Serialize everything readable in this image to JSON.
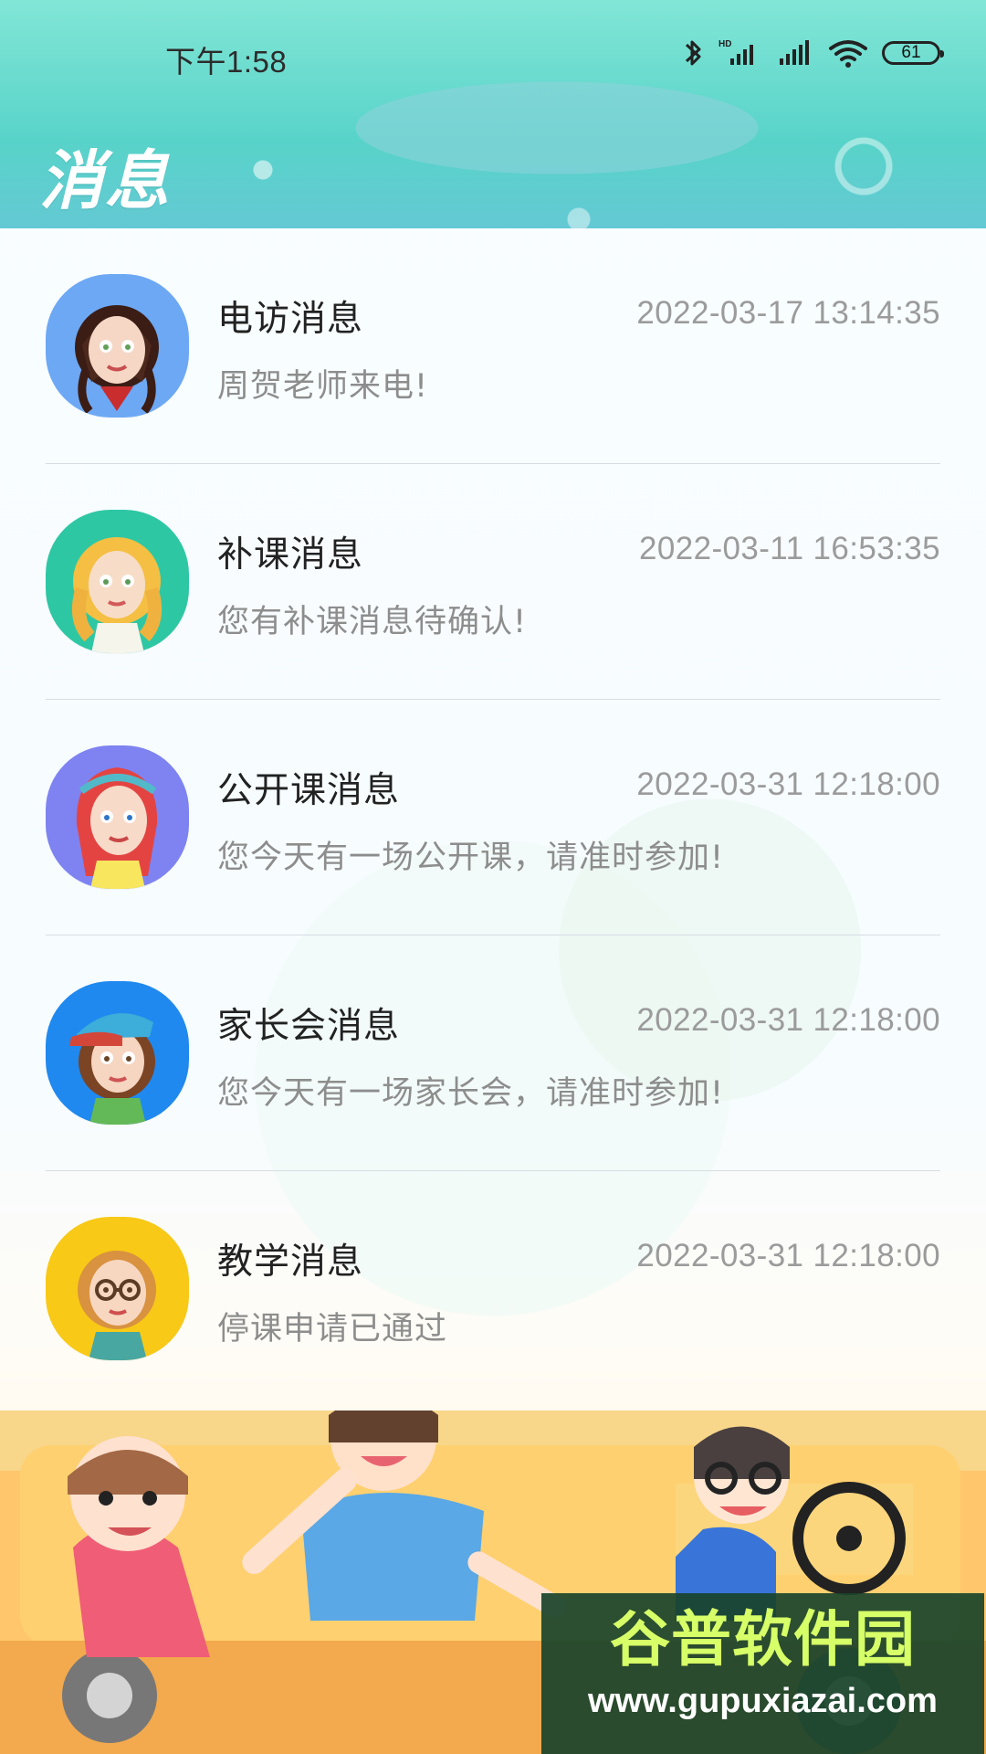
{
  "status_bar": {
    "time": "下午1:58",
    "battery": "61",
    "icons": [
      "bluetooth-icon",
      "hd-signal-icon",
      "signal-icon",
      "wifi-icon",
      "battery-icon"
    ]
  },
  "header": {
    "title": "消息"
  },
  "messages": [
    {
      "title": "电访消息",
      "time": "2022-03-17 13:14:35",
      "description": "周贺老师来电!",
      "avatar": "girl-black-hair-avatar"
    },
    {
      "title": "补课消息",
      "time": "2022-03-11 16:53:35",
      "description": "您有补课消息待确认!",
      "avatar": "girl-blonde-hair-avatar"
    },
    {
      "title": "公开课消息",
      "time": "2022-03-31 12:18:00",
      "description": "您今天有一场公开课，请准时参加!",
      "avatar": "girl-red-hair-avatar"
    },
    {
      "title": "家长会消息",
      "time": "2022-03-31 12:18:00",
      "description": "您今天有一场家长会，请准时参加!",
      "avatar": "girl-cap-avatar"
    },
    {
      "title": "教学消息",
      "time": "2022-03-31 12:18:00",
      "description": "停课申请已通过",
      "avatar": "girl-glasses-avatar"
    }
  ],
  "watermark": {
    "title": "谷普软件园",
    "url": "www.gupuxiazai.com"
  },
  "colors": {
    "header": "#58d3c9",
    "title": "#ffffff",
    "message_title": "#222222",
    "message_meta": "#9b9b9b",
    "divider": "#d7dce3"
  }
}
